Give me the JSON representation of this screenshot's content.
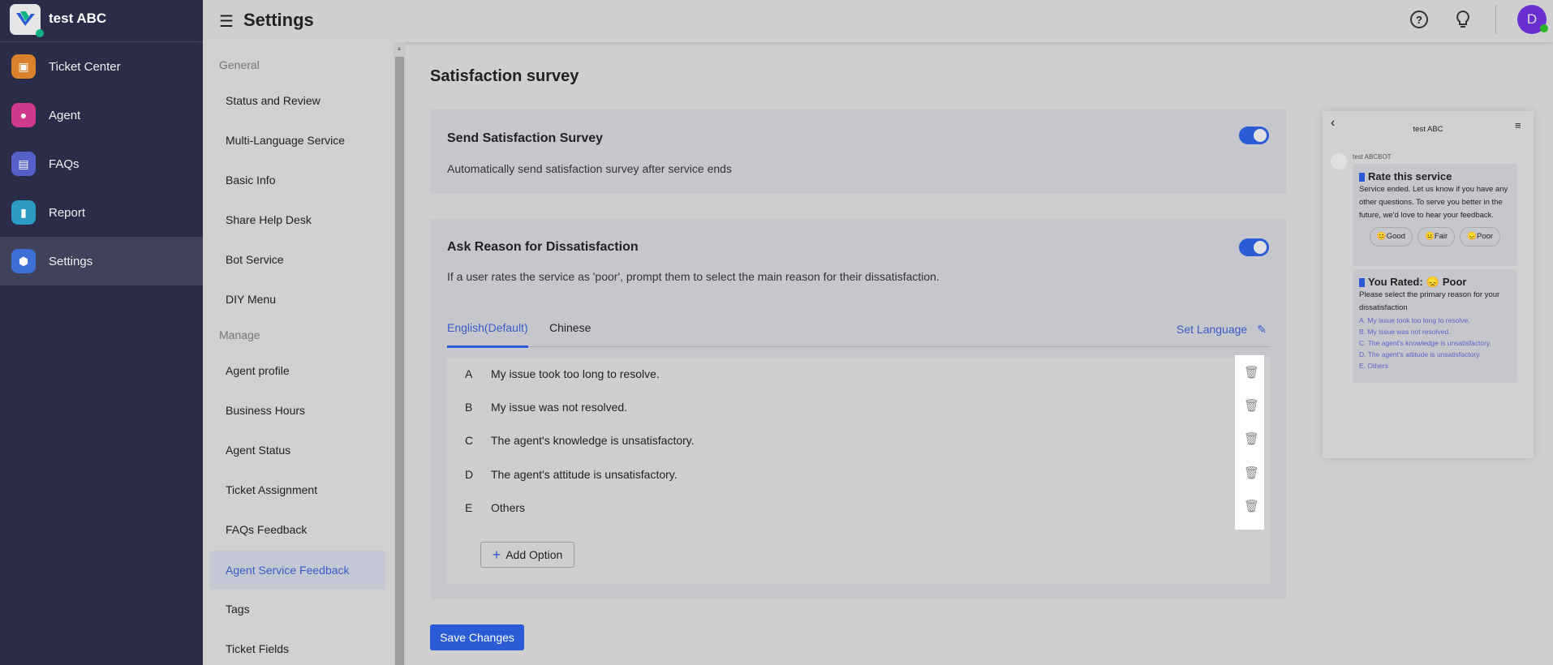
{
  "app": {
    "name": "test ABC"
  },
  "nav": [
    {
      "label": "Ticket Center",
      "icon": "ticket-icon",
      "color": "#d9822b"
    },
    {
      "label": "Agent",
      "icon": "agent-icon",
      "color": "#d03a8a"
    },
    {
      "label": "FAQs",
      "icon": "book-icon",
      "color": "#5561c9"
    },
    {
      "label": "Report",
      "icon": "chart-icon",
      "color": "#2b9bc4"
    },
    {
      "label": "Settings",
      "icon": "gear-icon",
      "color": "#3d6fd6"
    }
  ],
  "header": {
    "title": "Settings",
    "avatar": "D"
  },
  "subnav": {
    "general": "General",
    "general_items": [
      "Status and Review",
      "Multi-Language Service",
      "Basic Info",
      "Share Help Desk",
      "Bot Service",
      "DIY Menu"
    ],
    "manage": "Manage",
    "manage_items": [
      "Agent profile",
      "Business Hours",
      "Agent Status",
      "Ticket Assignment",
      "FAQs Feedback",
      "Agent Service Feedback",
      "Tags",
      "Ticket Fields"
    ]
  },
  "main": {
    "title": "Satisfaction survey",
    "send": {
      "title": "Send Satisfaction Survey",
      "desc": "Automatically send satisfaction survey after service ends",
      "enabled": true
    },
    "ask": {
      "title": "Ask Reason for Dissatisfaction",
      "desc": "If a user rates the service as 'poor', prompt them to select the main reason for their dissatisfaction.",
      "enabled": true
    },
    "tabs": [
      "English(Default)",
      "Chinese"
    ],
    "set_language": "Set Language",
    "options": [
      {
        "letter": "A",
        "text": "My issue took too long to resolve."
      },
      {
        "letter": "B",
        "text": "My issue was not resolved."
      },
      {
        "letter": "C",
        "text": "The agent's knowledge is unsatisfactory."
      },
      {
        "letter": "D",
        "text": "The agent's attitude is unsatisfactory."
      },
      {
        "letter": "E",
        "text": "Others"
      }
    ],
    "add_option": "Add Option",
    "save": "Save Changes"
  },
  "preview": {
    "title": "test ABC",
    "bot": "test ABCBOT",
    "rate_title": "Rate this service",
    "rate_desc": "Service ended. Let us know if you have any other questions. To serve you better in the future, we'd love to hear your feedback.",
    "ratings": [
      "Good",
      "Fair",
      "Poor"
    ],
    "rated_title": "You Rated:",
    "rated_value": "Poor",
    "reason_prompt": "Please select the primary reason for your dissatisfaction",
    "reasons": [
      "A. My issue took too long to resolve.",
      "B. My issue was not resolved.",
      "C. The agent's knowledge is unsatisfactory.",
      "D. The agent's attitude is unsatisfactory.",
      "E. Others"
    ]
  }
}
